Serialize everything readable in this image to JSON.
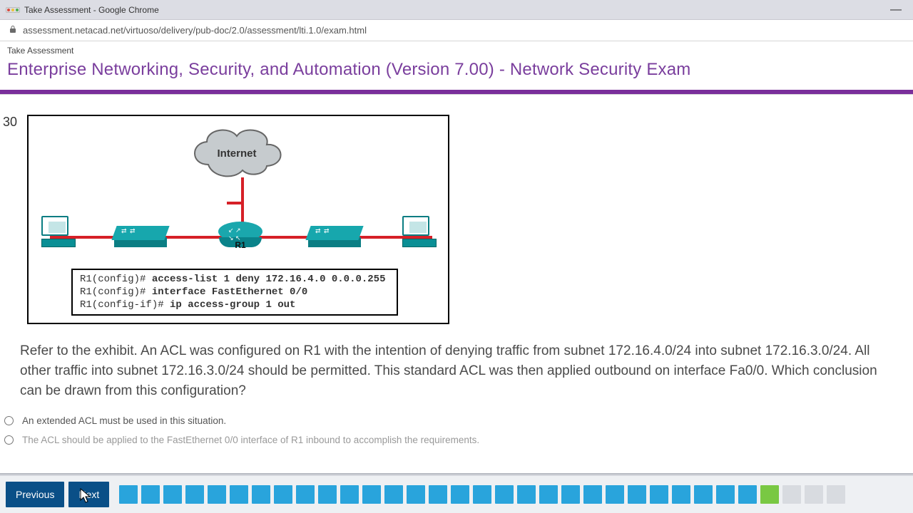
{
  "chrome": {
    "title": "Take Assessment - Google Chrome",
    "url": "assessment.netacad.net/virtuoso/delivery/pub-doc/2.0/assessment/lti.1.0/exam.html"
  },
  "header": {
    "crumb": "Take Assessment",
    "exam_title": "Enterprise Networking, Security, and Automation (Version 7.00) - Network Security Exam"
  },
  "question": {
    "number": "30",
    "exhibit": {
      "cloud_label": "Internet",
      "router_label": "R1",
      "code_lines": [
        {
          "prompt": "R1(config)# ",
          "cmd": "access-list 1 deny 172.16.4.0 0.0.0.255"
        },
        {
          "prompt": "R1(config)# ",
          "cmd": "interface FastEthernet 0/0"
        },
        {
          "prompt": "R1(config-if)# ",
          "cmd": "ip access-group 1 out"
        }
      ]
    },
    "text": "Refer to the exhibit. An ACL was configured on R1 with the intention of denying traffic from subnet 172.16.4.0/24 into subnet 172.16.3.0/24. All other traffic into subnet 172.16.3.0/24 should be permitted. This standard ACL was then applied outbound on interface Fa0/0. Which conclusion can be drawn from this configuration?",
    "options": [
      {
        "label": "An extended ACL must be used in this situation."
      },
      {
        "label": "The ACL should be applied to the FastEthernet 0/0 interface of R1 inbound to accomplish the requirements."
      }
    ]
  },
  "nav": {
    "previous_label": "Previous",
    "next_label": "Next",
    "items": [
      {
        "state": "answered"
      },
      {
        "state": "answered"
      },
      {
        "state": "answered"
      },
      {
        "state": "answered"
      },
      {
        "state": "answered"
      },
      {
        "state": "answered"
      },
      {
        "state": "answered"
      },
      {
        "state": "answered"
      },
      {
        "state": "answered"
      },
      {
        "state": "answered"
      },
      {
        "state": "answered"
      },
      {
        "state": "answered"
      },
      {
        "state": "answered"
      },
      {
        "state": "answered"
      },
      {
        "state": "answered"
      },
      {
        "state": "answered"
      },
      {
        "state": "answered"
      },
      {
        "state": "answered"
      },
      {
        "state": "answered"
      },
      {
        "state": "answered"
      },
      {
        "state": "answered"
      },
      {
        "state": "answered"
      },
      {
        "state": "answered"
      },
      {
        "state": "answered"
      },
      {
        "state": "answered"
      },
      {
        "state": "answered"
      },
      {
        "state": "answered"
      },
      {
        "state": "answered"
      },
      {
        "state": "answered"
      },
      {
        "state": "active"
      },
      {
        "state": "empty"
      },
      {
        "state": "empty"
      },
      {
        "state": "empty"
      }
    ]
  }
}
